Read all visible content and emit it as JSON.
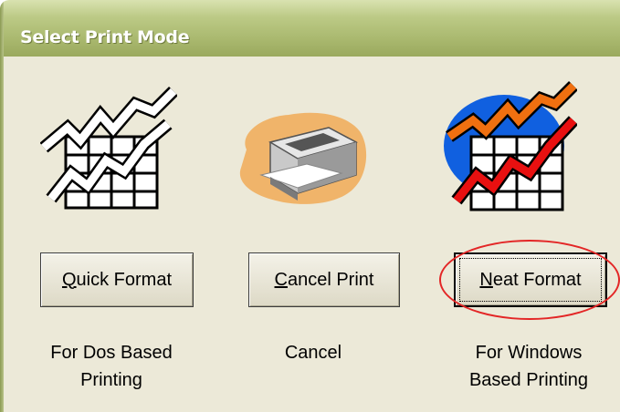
{
  "window": {
    "title": "Select Print Mode"
  },
  "options": [
    {
      "button_label_accel": "Q",
      "button_label_rest": "uick Format",
      "caption_line1": "For Dos Based",
      "caption_line2": "Printing",
      "icon": "line-chart-plain-icon"
    },
    {
      "button_label_accel": "C",
      "button_label_rest": "ancel Print",
      "caption_line1": "Cancel",
      "caption_line2": "",
      "icon": "printer-icon"
    },
    {
      "button_label_accel": "N",
      "button_label_rest": "eat Format",
      "caption_line1": "For Windows",
      "caption_line2": "Based Printing",
      "icon": "line-chart-color-icon"
    }
  ],
  "highlight": {
    "color": "#e32626",
    "target": "neat-format-button"
  }
}
